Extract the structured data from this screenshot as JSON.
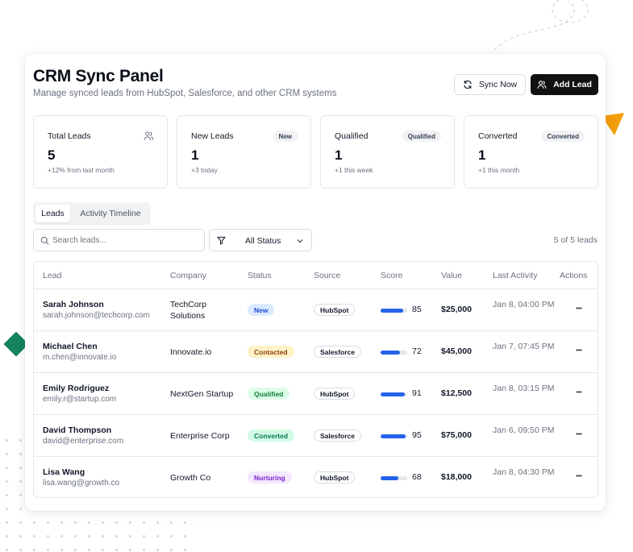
{
  "header": {
    "title": "CRM Sync Panel",
    "subtitle": "Manage synced leads from HubSpot, Salesforce, and other CRM systems",
    "sync_label": "Sync Now",
    "add_label": "Add Lead"
  },
  "cards": [
    {
      "label": "Total Leads",
      "value": "5",
      "sub": "+12% from last month",
      "icon": "users-icon"
    },
    {
      "label": "New Leads",
      "value": "1",
      "sub": "+3 today",
      "badge": "New"
    },
    {
      "label": "Qualified",
      "value": "1",
      "sub": "+1 this week",
      "badge": "Qualified"
    },
    {
      "label": "Converted",
      "value": "1",
      "sub": "+1 this month",
      "badge": "Converted"
    }
  ],
  "tabs": [
    "Leads",
    "Activity Timeline"
  ],
  "search": {
    "placeholder": "Search leads..."
  },
  "filter": {
    "label": "All Status"
  },
  "count_text": "5 of 5 leads",
  "table": {
    "headers": [
      "Lead",
      "Company",
      "Status",
      "Source",
      "Score",
      "Value",
      "Last Activity",
      "Actions"
    ],
    "rows": [
      {
        "name": "Sarah Johnson",
        "email": "sarah.johnson@techcorp.com",
        "company": "TechCorp Solutions",
        "status": "New",
        "source": "HubSpot",
        "score": 85,
        "value": "$25,000",
        "activity": "Jan 8, 04:00 PM"
      },
      {
        "name": "Michael Chen",
        "email": "m.chen@innovate.io",
        "company": "Innovate.io",
        "status": "Contacted",
        "source": "Salesforce",
        "score": 72,
        "value": "$45,000",
        "activity": "Jan 7, 07:45 PM"
      },
      {
        "name": "Emily Rodriguez",
        "email": "emily.r@startup.com",
        "company": "NextGen Startup",
        "status": "Qualified",
        "source": "HubSpot",
        "score": 91,
        "value": "$12,500",
        "activity": "Jan 8, 03:15 PM"
      },
      {
        "name": "David Thompson",
        "email": "david@enterprise.com",
        "company": "Enterprise Corp",
        "status": "Converted",
        "source": "Salesforce",
        "score": 95,
        "value": "$75,000",
        "activity": "Jan 6, 09:50 PM"
      },
      {
        "name": "Lisa Wang",
        "email": "lisa.wang@growth.co",
        "company": "Growth Co",
        "status": "Nurturing",
        "source": "HubSpot",
        "score": 68,
        "value": "$18,000",
        "activity": "Jan 8, 04:30 PM"
      }
    ]
  },
  "status_colors": {
    "New": {
      "bg": "#dbeafe",
      "fg": "#1d4ed8"
    },
    "Contacted": {
      "bg": "#fef3c7",
      "fg": "#92400e"
    },
    "Qualified": {
      "bg": "#dcfce7",
      "fg": "#15803d"
    },
    "Converted": {
      "bg": "#d1fae5",
      "fg": "#047857"
    },
    "Nurturing": {
      "bg": "#f3e8ff",
      "fg": "#7e22ce"
    }
  },
  "colors": {
    "accent": "#2563eb",
    "primary_button": "#111111"
  }
}
